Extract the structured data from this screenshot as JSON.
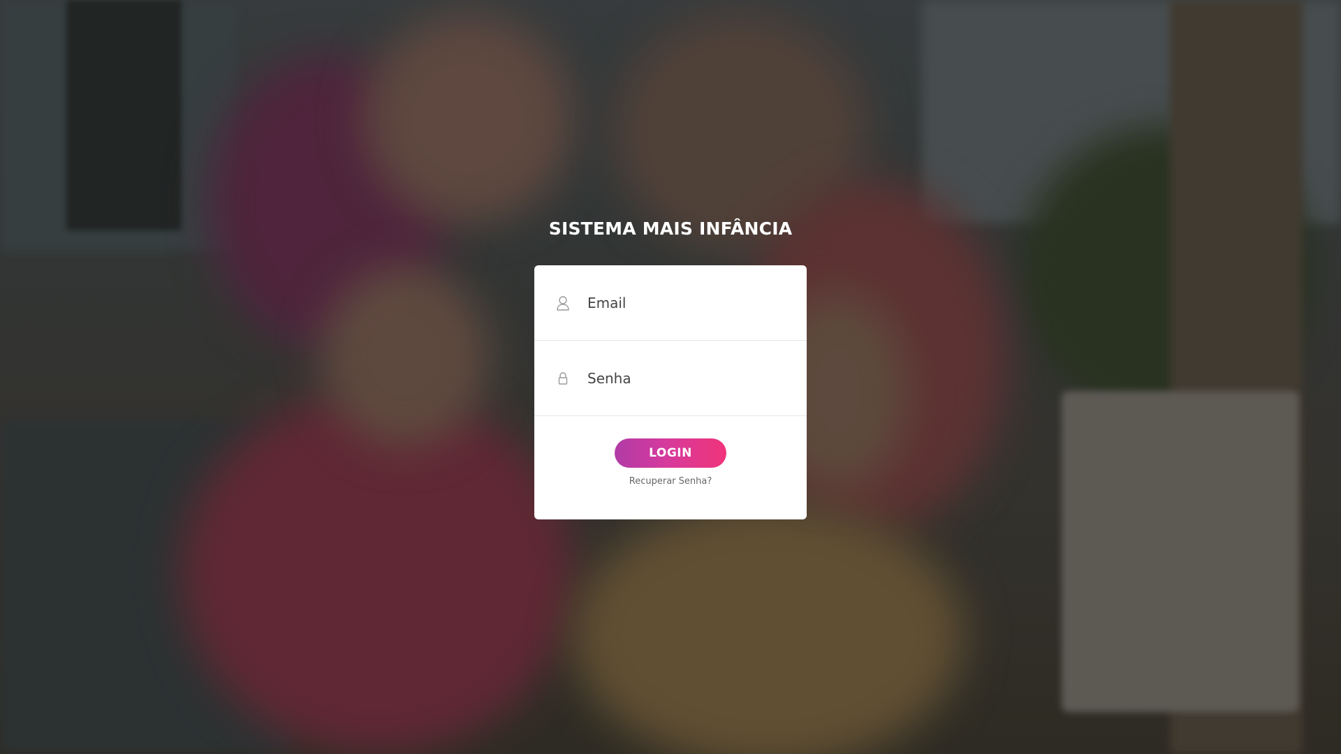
{
  "app": {
    "title": "SISTEMA MAIS INFÂNCIA"
  },
  "login": {
    "email": {
      "placeholder": "Email",
      "value": "",
      "icon": "user-icon"
    },
    "password": {
      "placeholder": "Senha",
      "value": "",
      "icon": "lock-icon"
    },
    "submit_label": "LOGIN",
    "forgot_label": "Recuperar Senha?"
  },
  "colors": {
    "button_gradient_start": "#b13ba6",
    "button_gradient_end": "#f0347a",
    "card_background": "#ffffff",
    "title_text": "#ffffff"
  }
}
